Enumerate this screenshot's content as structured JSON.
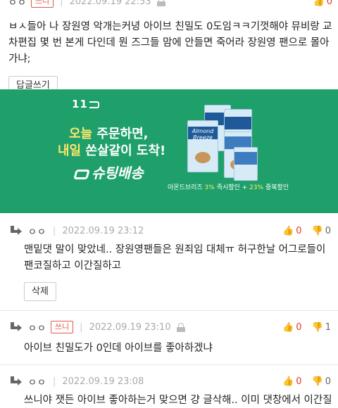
{
  "top_comment": {
    "nick": "ㅇㅇ",
    "badge": "쓰니",
    "date": "2022.09.19 22:53",
    "text": "ㅂㅅ들아 나 장원영 악개는커녕 아이브 친밀도 0도임ㅋㅋ기껏해야 뮤비랑 교차편집 몇 번 본게 다인데 뭔 즈그들 맘에 안들면 죽어라 장원영 팬으로 몰아가냐;",
    "reply_button": "답글쓰기"
  },
  "ad": {
    "logo": "11",
    "line1_highlight": "오늘",
    "line1_rest": " 주문하면,",
    "line2_highlight": "내일",
    "line2_rest": " 쏜살같이 도착!",
    "brand": "슈팅배송",
    "carton_label": "Almond Breeze",
    "caption_prefix": "아몬드브리즈 ",
    "caption_hl1": "3%",
    "caption_mid": " 즉시할인 + ",
    "caption_hl2": "23%",
    "caption_suffix": " 중복할인"
  },
  "comments": [
    {
      "nick": "ㅇㅇ",
      "badge": "",
      "date": "2022.09.19 23:12",
      "upvotes": "0",
      "downvotes": "0",
      "text": "맨밑댓 말이 맞았네.. 장원영팬들은 원죄임 대체ㅠ 허구한날 어그로들이 팬코질하고 이간질하고",
      "action_button": "삭제"
    },
    {
      "nick": "ㅇㅇ",
      "badge": "쓰니",
      "date": "2022.09.19 23:10",
      "upvotes": "0",
      "downvotes": "1",
      "text": "아이브 친밀도가 0인데 아이브를 좋아하겠냐"
    },
    {
      "nick": "ㅇㅇ",
      "badge": "",
      "date": "2022.09.19 23:08",
      "upvotes": "0",
      "downvotes": "0",
      "text": "쓰니야 잿든 아이브 좋아하는거 맞으면 걍 글삭해.. 이미 댓창에서 이간질하고"
    }
  ],
  "icons": {
    "thumb_up": "👍",
    "thumb_down": "👎"
  },
  "colors": {
    "ad_green": "#1fa06a",
    "upvote_red": "#e03b2c",
    "badge_red": "#e05a4a"
  }
}
